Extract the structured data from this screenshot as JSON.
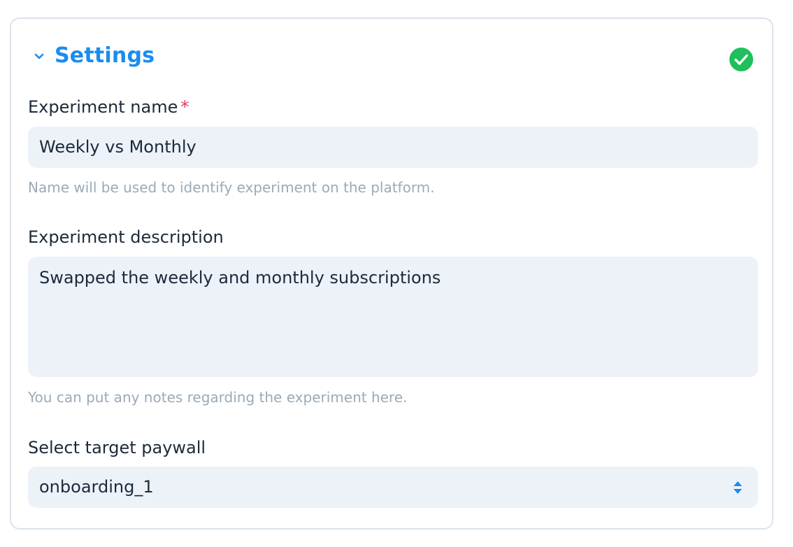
{
  "section": {
    "title": "Settings",
    "status": "complete",
    "accent_color": "#1a8cf0",
    "status_color": "#1fbf5b"
  },
  "fields": {
    "name": {
      "label": "Experiment name",
      "required_marker": "*",
      "value": "Weekly vs Monthly",
      "help": "Name will be used to identify experiment on the platform."
    },
    "description": {
      "label": "Experiment description",
      "value": "Swapped the weekly and monthly subscriptions",
      "help": "You can put any notes regarding the experiment here."
    },
    "paywall": {
      "label": "Select target paywall",
      "selected": "onboarding_1"
    }
  },
  "icons": {
    "collapse": "chevron-down-icon",
    "status": "check-circle-icon",
    "select": "sort-arrows-icon"
  }
}
